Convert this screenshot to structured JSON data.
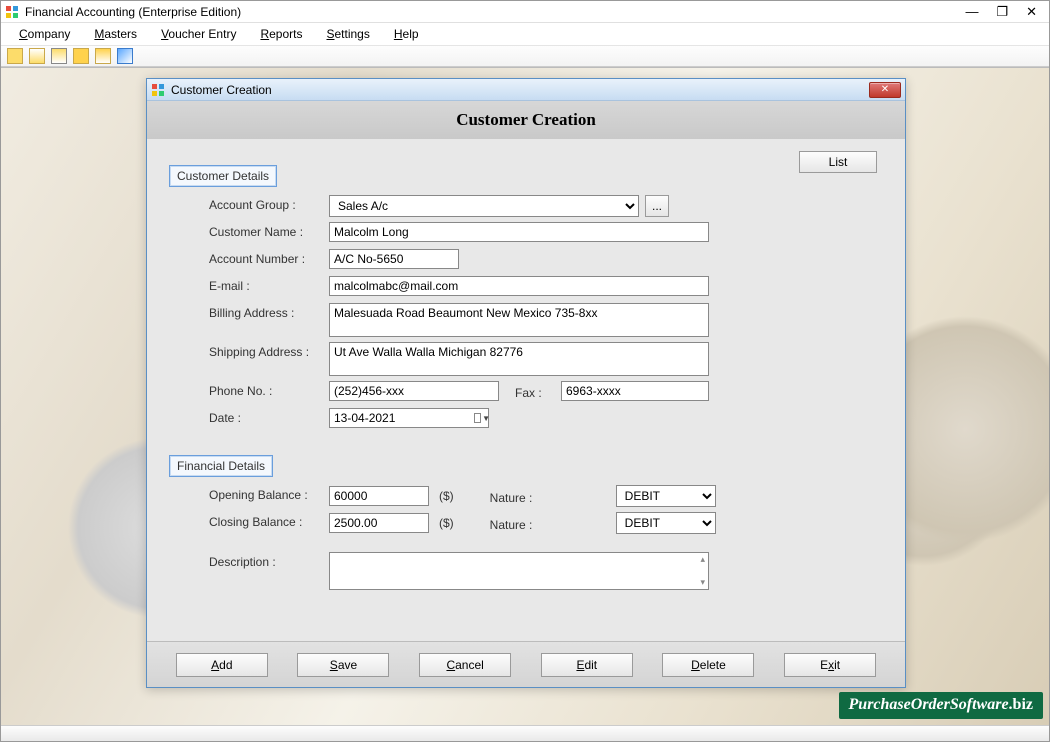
{
  "titlebar": {
    "title": "Financial Accounting (Enterprise Edition)"
  },
  "menubar": {
    "items": [
      {
        "pre": "",
        "ul": "C",
        "post": "ompany"
      },
      {
        "pre": "",
        "ul": "M",
        "post": "asters"
      },
      {
        "pre": "",
        "ul": "V",
        "post": "oucher Entry"
      },
      {
        "pre": "",
        "ul": "R",
        "post": "eports"
      },
      {
        "pre": "",
        "ul": "S",
        "post": "ettings"
      },
      {
        "pre": "",
        "ul": "H",
        "post": "elp"
      }
    ]
  },
  "dialog": {
    "titlebar": "Customer Creation",
    "header": "Customer Creation",
    "list_btn": "List",
    "section1": "Customer Details",
    "section2": "Financial Details",
    "labels": {
      "account_group": "Account Group :",
      "customer_name": "Customer Name :",
      "account_number": "Account Number :",
      "email": "E-mail :",
      "billing": "Billing Address :",
      "shipping": "Shipping Address :",
      "phone": "Phone No. :",
      "fax": "Fax :",
      "date": "Date :",
      "opening": "Opening Balance :",
      "closing": "Closing Balance :",
      "nature": "Nature :",
      "description": "Description :"
    },
    "values": {
      "account_group": "Sales A/c",
      "customer_name": "Malcolm Long",
      "account_number": "A/C No-5650",
      "email": "malcolmabc@mail.com",
      "billing": "Malesuada Road Beaumont New Mexico 735-8xx",
      "shipping": "Ut Ave Walla Walla Michigan 82776",
      "phone": "(252)456-xxx",
      "fax": "6963-xxxx",
      "date": "13-04-2021",
      "opening": "60000",
      "closing": "2500.00",
      "nature1": "DEBIT",
      "nature2": "DEBIT",
      "description": ""
    },
    "dollar": "($)",
    "ellipsis": "...",
    "footer": {
      "add": {
        "pre": "",
        "ul": "A",
        "post": "dd"
      },
      "save": {
        "pre": "",
        "ul": "S",
        "post": "ave"
      },
      "cancel": {
        "pre": "",
        "ul": "C",
        "post": "ancel"
      },
      "edit": {
        "pre": "",
        "ul": "E",
        "post": "dit"
      },
      "delete": {
        "pre": "",
        "ul": "D",
        "post": "elete"
      },
      "exit": {
        "pre": "E",
        "ul": "x",
        "post": "it"
      }
    }
  },
  "watermark": {
    "main": "PurchaseOrderSoftware",
    "suffix": ".biz"
  }
}
